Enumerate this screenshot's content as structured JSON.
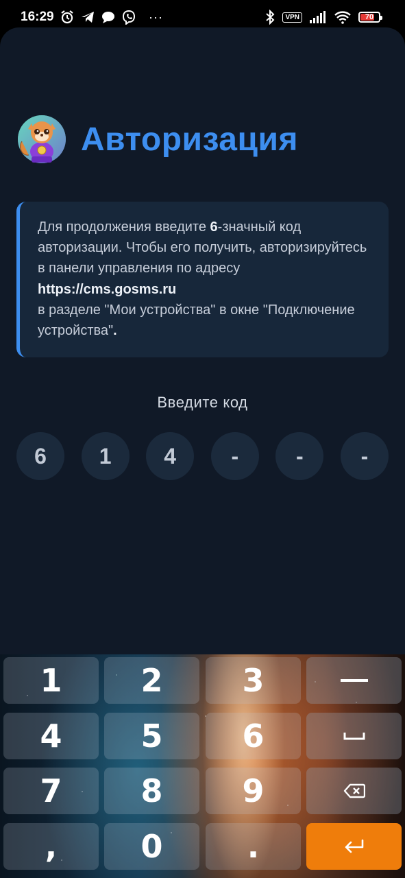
{
  "status_bar": {
    "time": "16:29",
    "vpn": "VPN",
    "battery": "70",
    "more": "···"
  },
  "app": {
    "title": "Авторизация",
    "info": {
      "part1": "Для продолжения введите ",
      "digits_count": "6",
      "part2": "-значный код авторизации. Чтобы его получить, авторизируйтесь в панели управления по адресу ",
      "url": "https://cms.gosms.ru",
      "part3": "в разделе \"Мои устройства\" в окне \"Подключение устройства\"",
      "part4": "."
    },
    "prompt": "Введите код",
    "code": [
      "6",
      "1",
      "4",
      "-",
      "-",
      "-"
    ]
  },
  "keyboard": {
    "keys": [
      "1",
      "2",
      "3",
      "4",
      "5",
      "6",
      "7",
      "8",
      "9",
      ",",
      "0",
      "."
    ],
    "icons": [
      "minus-icon",
      "space-icon",
      "backspace-icon",
      "enter-icon"
    ]
  },
  "colors": {
    "accent": "#3d8ef0",
    "background": "#101927",
    "card": "#17273a",
    "enter_key": "#ef7d0b"
  }
}
